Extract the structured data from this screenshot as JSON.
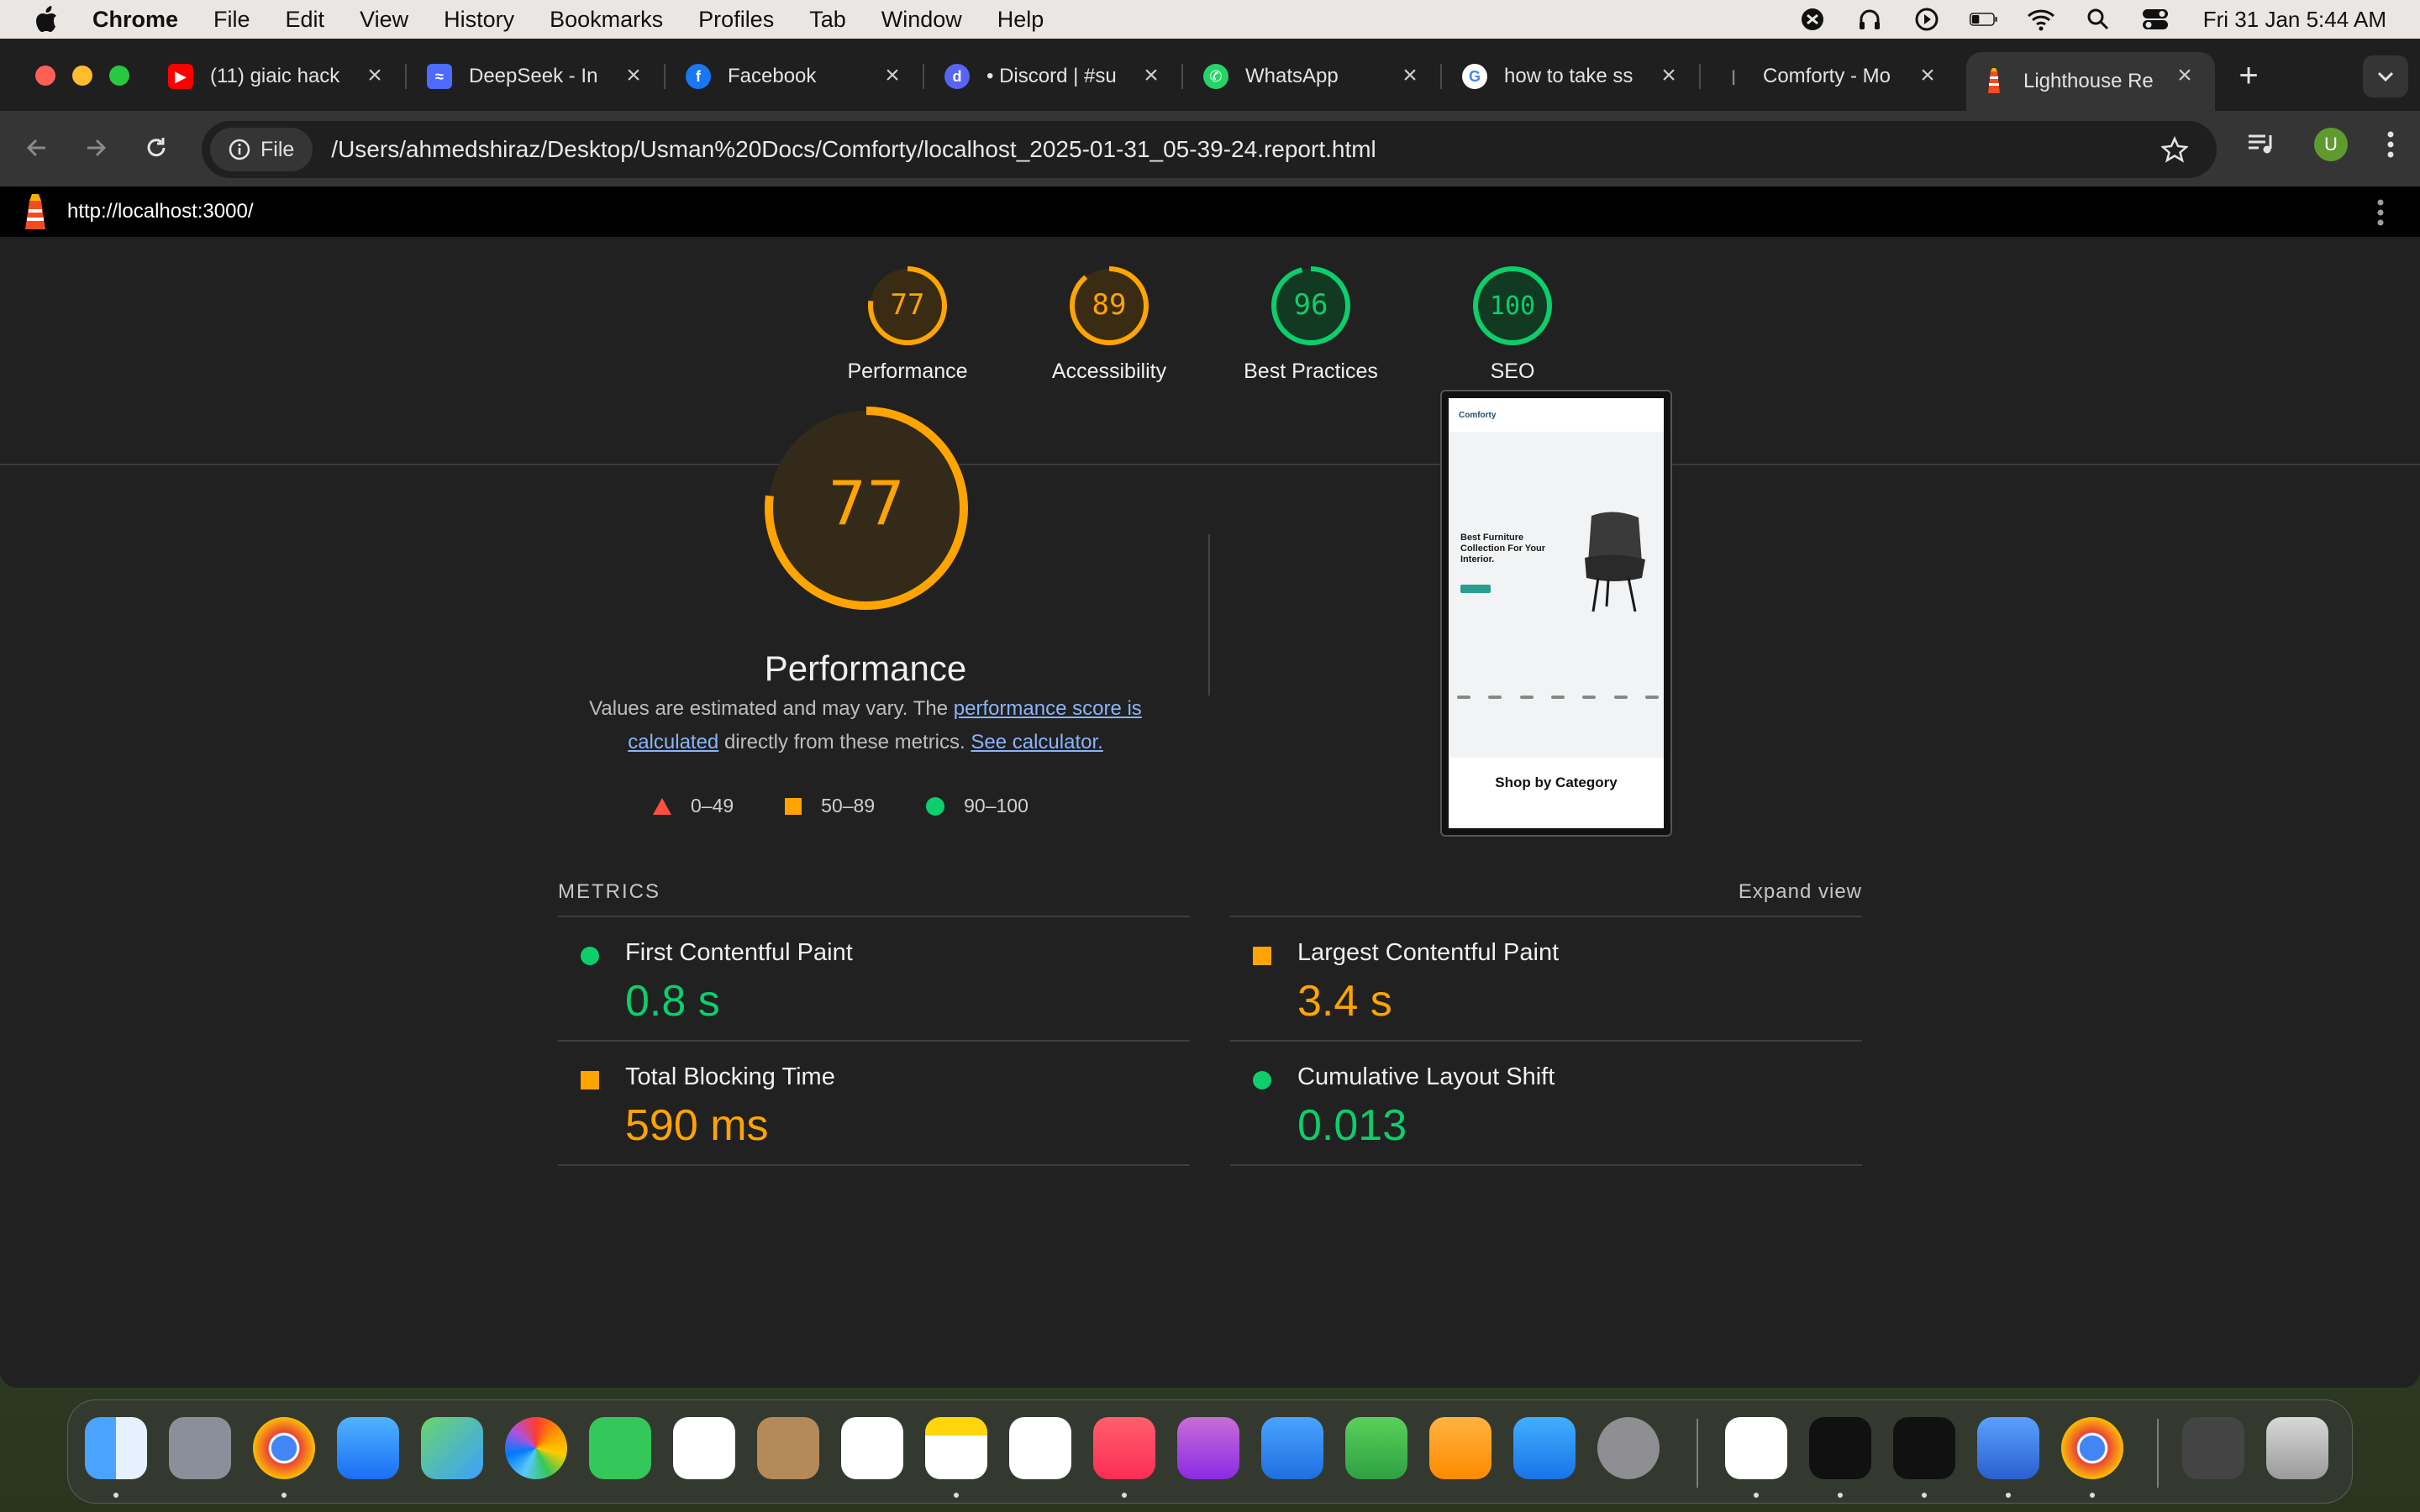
{
  "menubar": {
    "app": "Chrome",
    "items": [
      "File",
      "Edit",
      "View",
      "History",
      "Bookmarks",
      "Profiles",
      "Tab",
      "Window",
      "Help"
    ],
    "clock": "Fri 31 Jan  5:44 AM"
  },
  "tabs": [
    {
      "label": "(11) giaic hack",
      "icon": "youtube-icon",
      "color": "#ff0000"
    },
    {
      "label": "DeepSeek - In",
      "icon": "deepseek-icon",
      "color": "#4d6bfe"
    },
    {
      "label": "Facebook",
      "icon": "facebook-icon",
      "color": "#1877f2"
    },
    {
      "label": "• Discord | #su",
      "icon": "discord-icon",
      "color": "#5865f2"
    },
    {
      "label": "WhatsApp",
      "icon": "whatsapp-icon",
      "color": "#25d366"
    },
    {
      "label": "how to take ss",
      "icon": "google-icon",
      "color": "#ffffff"
    },
    {
      "label": "Comforty - Mo",
      "icon": "comforty-icon",
      "color": "#555555"
    },
    {
      "label": "Lighthouse Re",
      "icon": "lighthouse-icon",
      "color": "#f44b21",
      "active": true
    }
  ],
  "toolbar": {
    "chip_label": "File",
    "url": "/Users/ahmedshiraz/Desktop/Usman%20Docs/Comforty/localhost_2025-01-31_05-39-24.report.html",
    "avatar_letter": "U"
  },
  "lighthouse": {
    "page_url": "http://localhost:3000/",
    "scores": [
      {
        "label": "Performance",
        "value": "77",
        "score": 0.77,
        "color": "#ffa400"
      },
      {
        "label": "Accessibility",
        "value": "89",
        "score": 0.89,
        "color": "#ffa400"
      },
      {
        "label": "Best Practices",
        "value": "96",
        "score": 0.96,
        "color": "#0cce6b"
      },
      {
        "label": "SEO",
        "value": "100",
        "score": 1.0,
        "color": "#0cce6b"
      }
    ],
    "performance": {
      "score": "77",
      "title": "Performance",
      "desc_prefix": "Values are estimated and may vary. The ",
      "desc_link1": "performance score is calculated",
      "desc_mid": " directly from these metrics. ",
      "desc_link2": "See calculator."
    },
    "legend": [
      "0–49",
      "50–89",
      "90–100"
    ],
    "metrics_heading": "METRICS",
    "expand_label": "Expand view",
    "metrics": [
      {
        "name": "First Contentful Paint",
        "value": "0.8 s",
        "status": "pass"
      },
      {
        "name": "Largest Contentful Paint",
        "value": "3.4 s",
        "status": "average"
      },
      {
        "name": "Total Blocking Time",
        "value": "590 ms",
        "status": "average"
      },
      {
        "name": "Cumulative Layout Shift",
        "value": "0.013",
        "status": "pass"
      }
    ],
    "screenshot": {
      "brand": "Comforty",
      "hero": "Best Furniture Collection For Your Interior.",
      "section": "Shop by Category"
    }
  },
  "colors": {
    "pass": "#0cce6b",
    "average": "#ffa400",
    "fail": "#ff4e42"
  }
}
